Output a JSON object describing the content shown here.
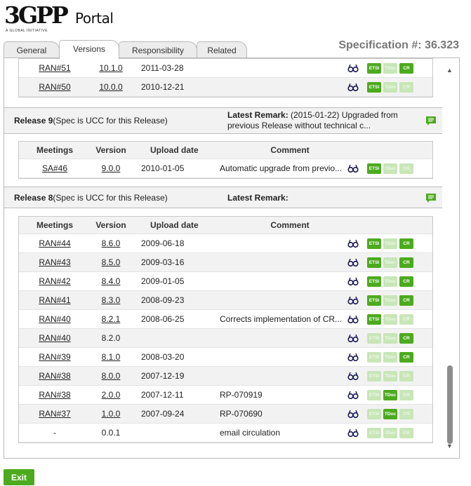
{
  "header": {
    "logo_text": "3GPP",
    "logo_tagline": "A GLOBAL INITIATIVE",
    "portal_label": "Portal"
  },
  "tabs": [
    {
      "label": "General"
    },
    {
      "label": "Versions"
    },
    {
      "label": "Responsibility"
    },
    {
      "label": "Related"
    }
  ],
  "spec_title": "Specification #: 36.323",
  "columns": {
    "meetings": "Meetings",
    "version": "Version",
    "upload_date": "Upload date",
    "comment": "Comment"
  },
  "badges": {
    "etsi": "ETSI",
    "tdoc": "TDoc",
    "cr": "CR"
  },
  "colors": {
    "accent": "#4caa1e",
    "badge_disabled": "#c8e6b8"
  },
  "release10_tail": [
    {
      "meeting": "RAN#51",
      "version": "10.1.0",
      "date": "2011-03-28",
      "comment": "",
      "etsi": true,
      "tdoc": false,
      "cr": true
    },
    {
      "meeting": "RAN#50",
      "version": "10.0.0",
      "date": "2010-12-21",
      "comment": "",
      "etsi": true,
      "tdoc": false,
      "cr": false
    }
  ],
  "release9": {
    "title": "Release 9",
    "note": "(Spec is UCC for this Release)",
    "remark_label": "Latest Remark:",
    "remark_text": "(2015-01-22) Upgraded from previous Release without technical c...",
    "rows": [
      {
        "meeting": "SA#46",
        "version": "9.0.0",
        "date": "2010-01-05",
        "comment": "Automatic upgrade from previo...",
        "etsi": true,
        "tdoc": false,
        "cr": false
      }
    ]
  },
  "release8": {
    "title": "Release 8",
    "note": "(Spec is UCC for this Release)",
    "remark_label": "Latest Remark:",
    "remark_text": "",
    "rows": [
      {
        "meeting": "RAN#44",
        "version": "8.6.0",
        "date": "2009-06-18",
        "comment": "",
        "etsi": true,
        "tdoc": false,
        "cr": true
      },
      {
        "meeting": "RAN#43",
        "version": "8.5.0",
        "date": "2009-03-16",
        "comment": "",
        "etsi": true,
        "tdoc": false,
        "cr": true
      },
      {
        "meeting": "RAN#42",
        "version": "8.4.0",
        "date": "2009-01-05",
        "comment": "",
        "etsi": true,
        "tdoc": false,
        "cr": true
      },
      {
        "meeting": "RAN#41",
        "version": "8.3.0",
        "date": "2008-09-23",
        "comment": "",
        "etsi": true,
        "tdoc": false,
        "cr": true
      },
      {
        "meeting": "RAN#40",
        "version": "8.2.1",
        "date": "2008-06-25",
        "comment": "Corrects implementation of CR...",
        "etsi": true,
        "tdoc": false,
        "cr": false
      },
      {
        "meeting": "RAN#40",
        "version": "8.2.0",
        "date": "",
        "comment": "",
        "etsi": false,
        "tdoc": false,
        "cr": true
      },
      {
        "meeting": "RAN#39",
        "version": "8.1.0",
        "date": "2008-03-20",
        "comment": "",
        "etsi": false,
        "tdoc": false,
        "cr": true
      },
      {
        "meeting": "RAN#38",
        "version": "8.0.0",
        "date": "2007-12-19",
        "comment": "",
        "etsi": false,
        "tdoc": false,
        "cr": false
      },
      {
        "meeting": "RAN#38",
        "version": "2.0.0",
        "date": "2007-12-11",
        "comment": "RP-070919",
        "etsi": false,
        "tdoc": true,
        "cr": false
      },
      {
        "meeting": "RAN#37",
        "version": "1.0.0",
        "date": "2007-09-24",
        "comment": "RP-070690",
        "etsi": false,
        "tdoc": true,
        "cr": false
      },
      {
        "meeting": "-",
        "version": "0.0.1",
        "date": "",
        "comment": "email circulation",
        "etsi": false,
        "tdoc": false,
        "cr": false
      }
    ]
  },
  "footer": {
    "exit_label": "Exit"
  }
}
